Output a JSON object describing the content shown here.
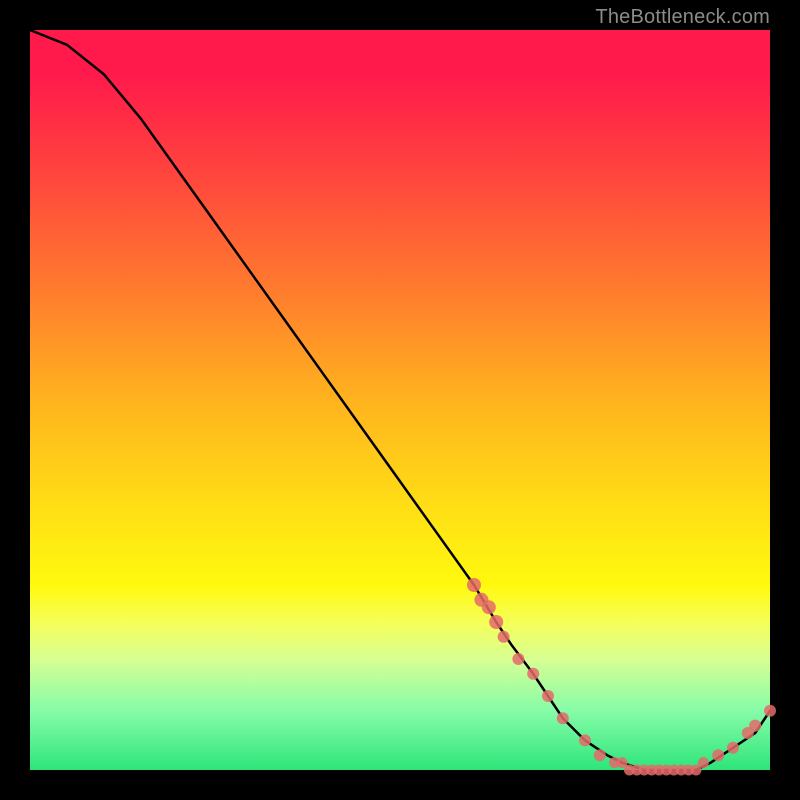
{
  "attribution": "TheBottleneck.com",
  "colors": {
    "background": "#000000",
    "line": "#000000",
    "marker": "#e46a6a",
    "gradient_top": "#ff1a4b",
    "gradient_bottom": "#2ee57a"
  },
  "chart_data": {
    "type": "line",
    "title": "",
    "xlabel": "",
    "ylabel": "",
    "xlim": [
      0,
      100
    ],
    "ylim": [
      0,
      100
    ],
    "x": [
      0,
      5,
      10,
      15,
      20,
      25,
      30,
      35,
      40,
      45,
      50,
      55,
      60,
      63,
      65,
      68,
      70,
      72,
      75,
      78,
      80,
      83,
      85,
      88,
      90,
      92,
      95,
      98,
      100
    ],
    "values": [
      100,
      98,
      94,
      88,
      81,
      74,
      67,
      60,
      53,
      46,
      39,
      32,
      25,
      20,
      17,
      13,
      10,
      7,
      4,
      2,
      1,
      0,
      0,
      0,
      0,
      1,
      3,
      5,
      8
    ],
    "markers_x": [
      60,
      61,
      62,
      63,
      64,
      66,
      68,
      70,
      72,
      75,
      77,
      79,
      80,
      81,
      82,
      83,
      84,
      85,
      86,
      87,
      88,
      89,
      90,
      91,
      93,
      95,
      97,
      98,
      100
    ],
    "markers_y": [
      25,
      23,
      22,
      20,
      18,
      15,
      13,
      10,
      7,
      4,
      2,
      1,
      1,
      0,
      0,
      0,
      0,
      0,
      0,
      0,
      0,
      0,
      0,
      1,
      2,
      3,
      5,
      6,
      8
    ]
  }
}
